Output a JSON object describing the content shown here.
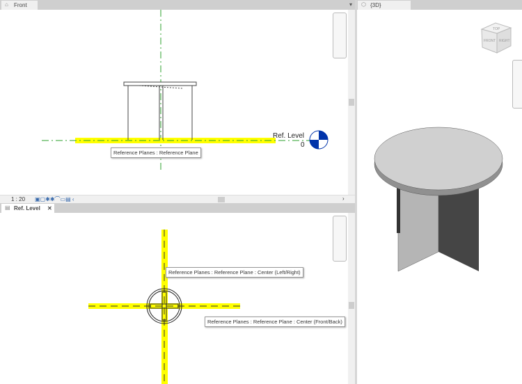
{
  "views": {
    "front": {
      "tab": "Front",
      "scale": "1 : 20",
      "level_name": "Ref. Level",
      "level_elev": "0",
      "tooltip": "Reference Planes : Reference Plane"
    },
    "plan": {
      "tab": "Ref. Level",
      "close": "✕",
      "tooltip1": "Reference Planes : Reference Plane : Center (Left/Right)",
      "tooltip2": "Reference Planes : Reference Plane : Center (Front/Back)"
    },
    "threeD": {
      "tab": "{3D}",
      "viewcube": {
        "top": "TOP",
        "front": "FRONT",
        "right": "RIGHT"
      }
    }
  },
  "colors": {
    "highlight": "#ffff00",
    "ref_plane": "#2ea02e",
    "level_head": "#0033aa"
  }
}
